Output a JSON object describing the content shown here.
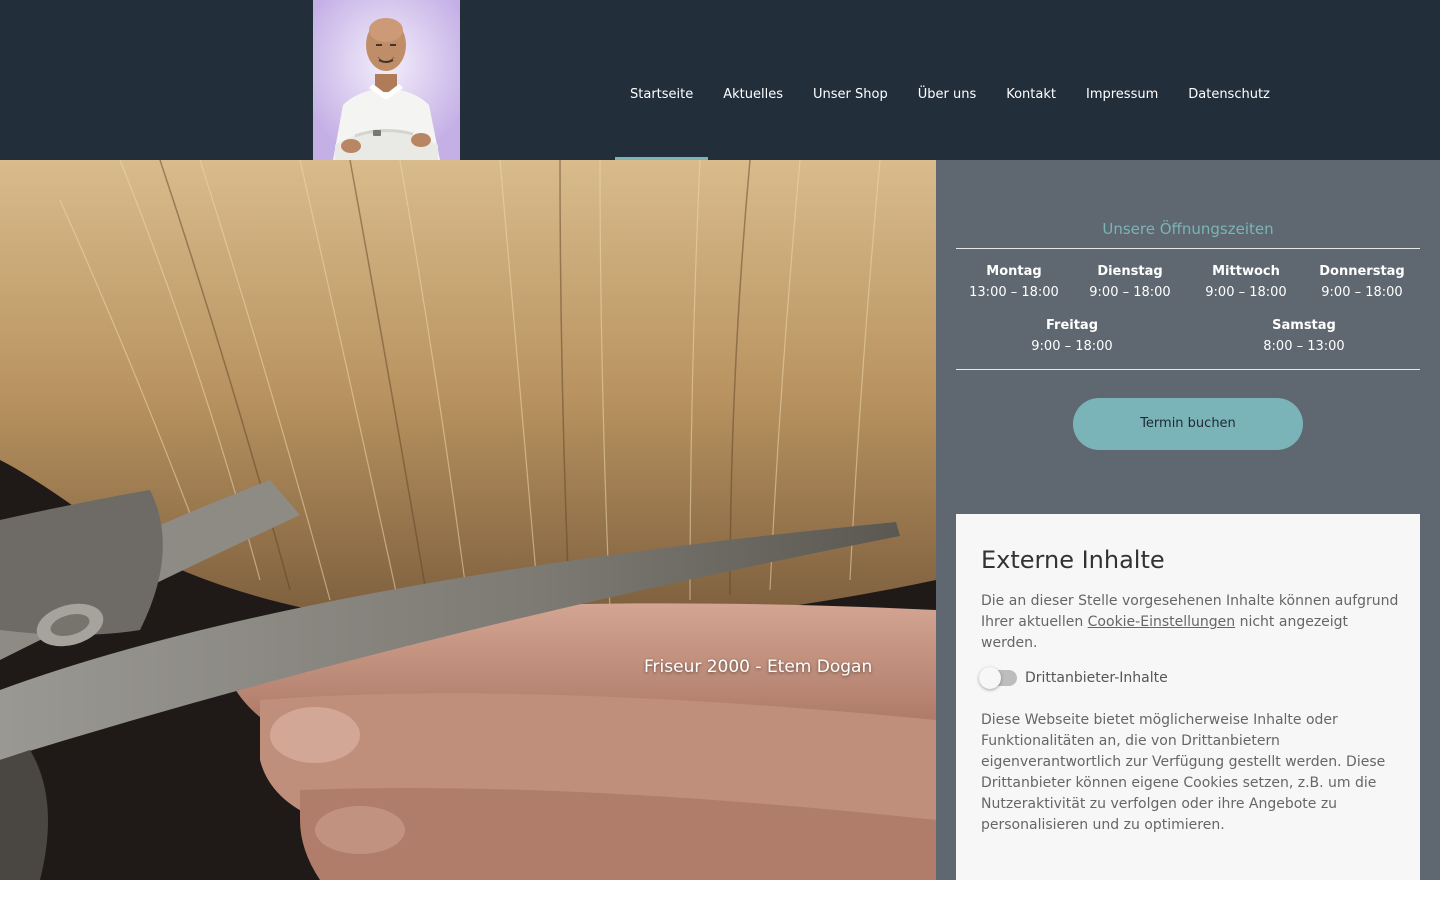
{
  "header": {
    "nav": [
      {
        "label": "Startseite",
        "active": true
      },
      {
        "label": "Aktuelles"
      },
      {
        "label": "Unser Shop"
      },
      {
        "label": "Über uns"
      },
      {
        "label": "Kontakt"
      },
      {
        "label": "Impressum"
      },
      {
        "label": "Datenschutz"
      }
    ]
  },
  "hero": {
    "caption": "Friseur 2000 - Etem Dogan"
  },
  "hours": {
    "title": "Unsere Öffnungszeiten",
    "days": [
      {
        "name": "Montag",
        "time": "13:00 – 18:00"
      },
      {
        "name": "Dienstag",
        "time": "9:00 – 18:00"
      },
      {
        "name": "Mittwoch",
        "time": "9:00 – 18:00"
      },
      {
        "name": "Donnerstag",
        "time": "9:00 – 18:00"
      },
      {
        "name": "Freitag",
        "time": "9:00 – 18:00"
      },
      {
        "name": "Samstag",
        "time": "8:00 – 13:00"
      }
    ],
    "button_label": "Termin buchen"
  },
  "external": {
    "title": "Externe Inhalte",
    "p1_before": "Die an dieser Stelle vorgesehenen Inhalte können aufgrund Ihrer aktuellen ",
    "p1_link": "Cookie-Einstellungen",
    "p1_after": " nicht angezeigt werden.",
    "toggle_label": "Drittanbieter-Inhalte",
    "toggle_on": false,
    "p2": "Diese Webseite bietet möglicherweise Inhalte oder Funktionalitäten an, die von Drittanbietern eigenverantwortlich zur Verfügung gestellt werden. Diese Drittanbieter können eigene Cookies setzen, z.B. um die Nutzeraktivität zu verfolgen oder ihre Angebote zu personalisieren und zu optimieren."
  },
  "colors": {
    "header_bg": "#232e3b",
    "accent": "#7ab4b8",
    "sidebar_bg": "#5f6770"
  }
}
